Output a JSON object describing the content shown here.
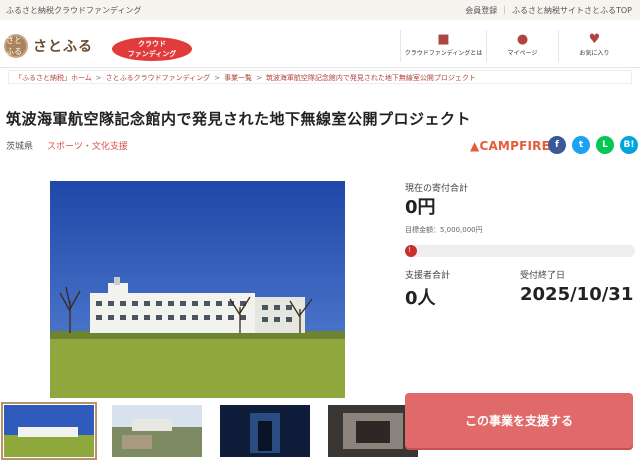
{
  "topbar": {
    "tagline": "ふるさと納税クラウドファンディング",
    "links": [
      "会員登録",
      "ふるさと納税サイトさとふるTOP"
    ]
  },
  "header": {
    "logo_mark": "さとふる",
    "logo_text": "さとふる",
    "badge_line1": "クラウド",
    "badge_line2": "ファンディング",
    "nav": [
      {
        "label": "クラウドファンディングとは",
        "icon": "book-icon"
      },
      {
        "label": "マイページ",
        "icon": "person-icon"
      },
      {
        "label": "お気に入り",
        "icon": "heart-icon"
      }
    ]
  },
  "breadcrumb": [
    "「ふるさと納税」ホーム",
    "さとふるクラウドファンディング",
    "事業一覧",
    "筑波海軍航空隊記念館内で発見された地下無線室公開プロジェクト"
  ],
  "project": {
    "title": "筑波海軍航空隊記念館内で発見された地下無線室公開プロジェクト",
    "region": "茨城県",
    "category": "スポーツ・文化支援",
    "partner": "CAMPFIRE"
  },
  "share": [
    {
      "label": "f",
      "icon": "facebook-icon",
      "color": "#3b5998"
    },
    {
      "label": "t",
      "icon": "twitter-icon",
      "color": "#1da1f2"
    },
    {
      "label": "L",
      "icon": "line-icon",
      "color": "#06c755"
    },
    {
      "label": "B!",
      "icon": "hatena-icon",
      "color": "#00a4de"
    }
  ],
  "stats": {
    "donation_label": "現在の寄付合計",
    "donation_value": "0円",
    "goal_text": "目標金額：5,000,000円",
    "progress_percent": 0,
    "progress_mark": "!",
    "supporters_label": "支援者合計",
    "supporters_value": "0人",
    "deadline_label": "受付終了日",
    "deadline_value": "2025/10/31"
  },
  "cta": {
    "label": "この事業を支援する"
  },
  "colors": {
    "accent": "#e06a6a",
    "brand_red": "#d9534f",
    "progress": "#c9302c"
  }
}
